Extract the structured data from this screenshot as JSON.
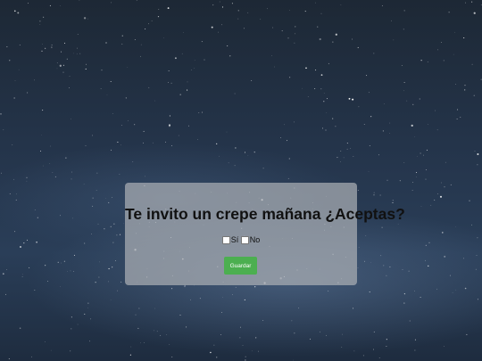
{
  "dialog": {
    "question": "Te invito un crepe mañana ¿Aceptas?",
    "options": [
      {
        "label": "Sí",
        "checked": false
      },
      {
        "label": "No",
        "checked": false
      }
    ],
    "save_label": "Guardar"
  },
  "colors": {
    "background": "#24344a",
    "card": "#aaafb4",
    "button": "#4caf50",
    "button_text": "#ffffff",
    "text": "#111111"
  }
}
